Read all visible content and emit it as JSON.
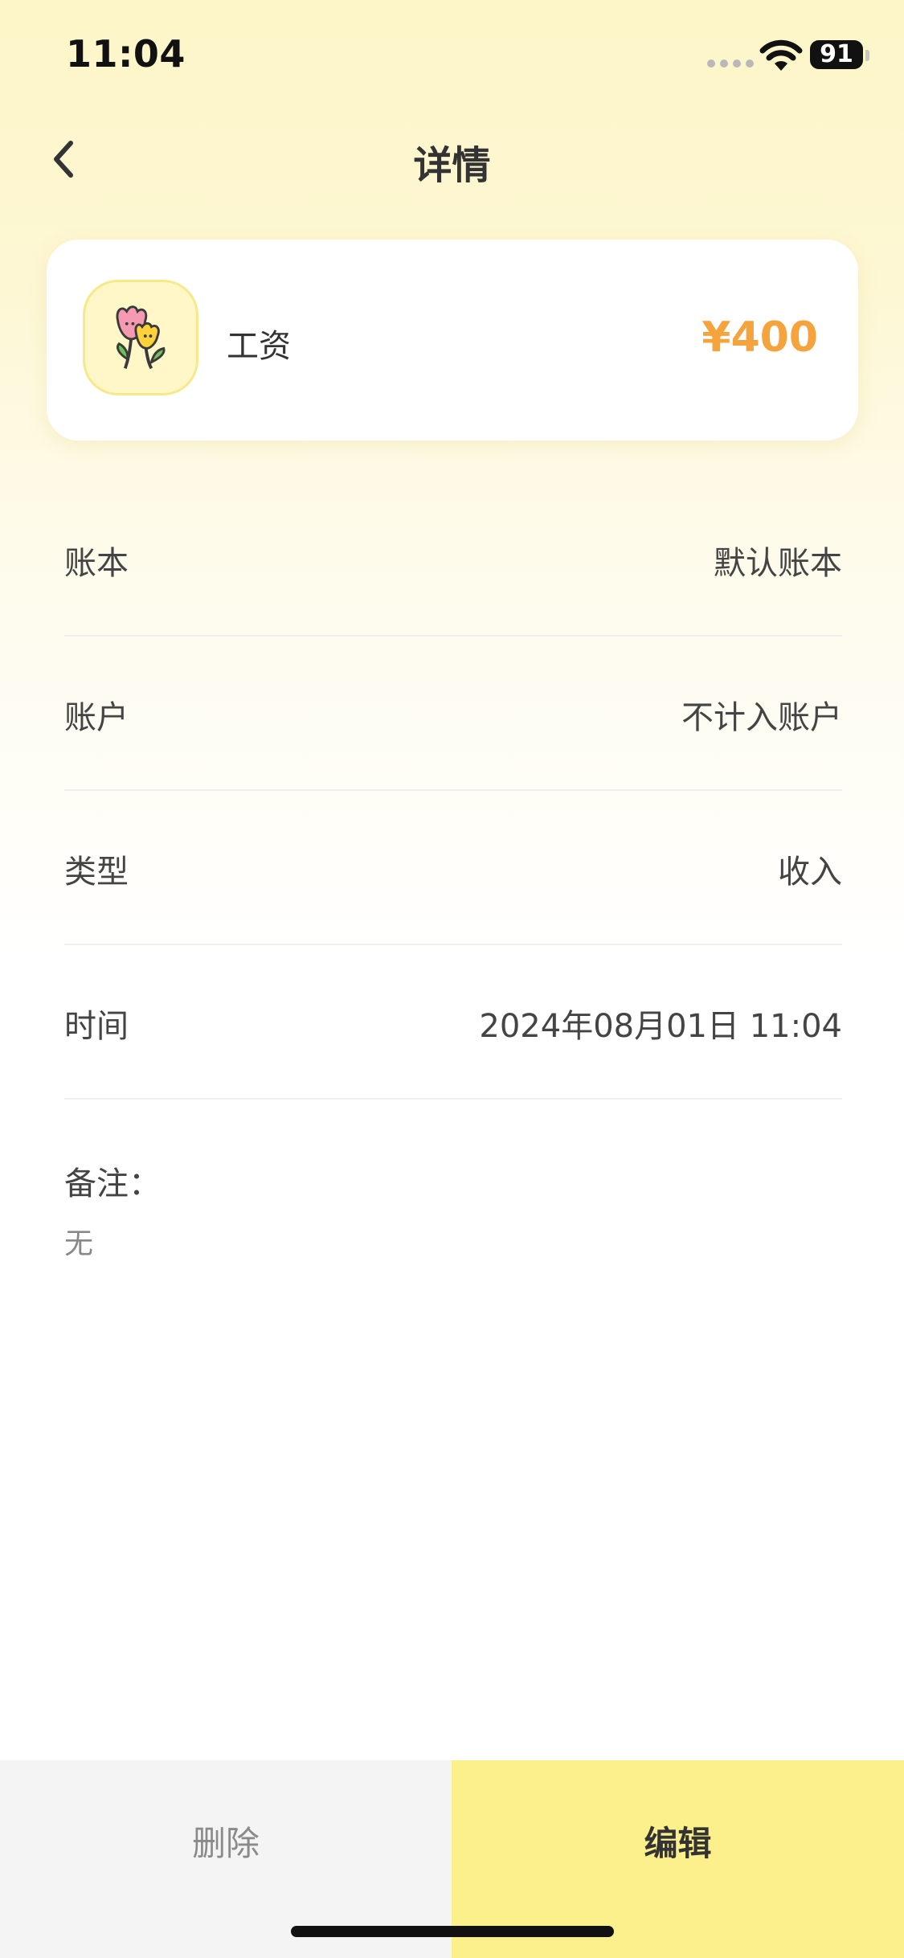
{
  "status_bar": {
    "time": "11:04",
    "battery": "91",
    "signal_icon": "cellular-signal-icon",
    "wifi_icon": "wifi-icon"
  },
  "header": {
    "title": "详情",
    "back_icon": "chevron-left-icon"
  },
  "summary": {
    "category_icon": "tulip-flowers-icon",
    "category": "工资",
    "amount": "¥400",
    "amount_color": "#f5a33c"
  },
  "details": {
    "rows": [
      {
        "label": "账本",
        "value": "默认账本"
      },
      {
        "label": "账户",
        "value": "不计入账户"
      },
      {
        "label": "类型",
        "value": "收入"
      },
      {
        "label": "时间",
        "value": "2024年08月01日 11:04"
      }
    ],
    "note_label": "备注：",
    "note_value": "无"
  },
  "actions": {
    "delete_label": "删除",
    "edit_label": "编辑",
    "edit_color": "#fcf08c"
  }
}
